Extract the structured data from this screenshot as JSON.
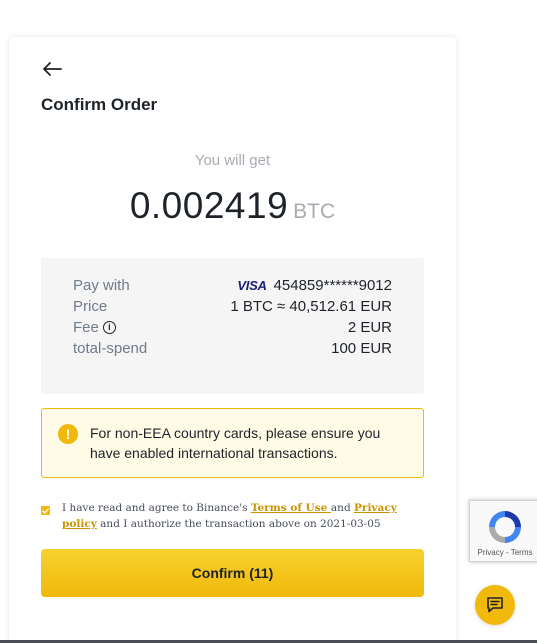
{
  "order": {
    "title": "Confirm Order",
    "you_will_get_label": "You will get",
    "amount": "0.002419",
    "currency": "BTC"
  },
  "details": {
    "pay_with_label": "Pay with",
    "card_brand": "VISA",
    "card_number": "454859******9012",
    "price_label": "Price",
    "price_value": "1 BTC ≈ 40,512.61 EUR",
    "fee_label": "Fee",
    "fee_value": "2 EUR",
    "total_label": "total-spend",
    "total_value": "100 EUR"
  },
  "warning": {
    "icon": "!",
    "text": "For non-EEA country cards, please ensure you have enabled international transactions."
  },
  "agreement": {
    "checked": true,
    "text_before": "I have read and agree to Binance's ",
    "terms_link": "Terms of Use ",
    "and_text": " and ",
    "privacy_link": "Privacy policy",
    "text_after": " and I authorize the transaction above on 2021-03-05"
  },
  "confirm_button": {
    "label": "Confirm (11)"
  },
  "recaptcha": {
    "privacy": "Privacy",
    "separator": " - ",
    "terms": "Terms"
  },
  "colors": {
    "accent": "#f0b90b",
    "accent_light": "#f8d12f",
    "link": "#c99400",
    "warning_bg": "#fefbe6",
    "details_bg": "#f5f5f5",
    "text_primary": "#1e2329",
    "text_secondary": "#707a8a",
    "text_muted": "#a7abb2"
  },
  "icons": {
    "back": "arrow-left-icon",
    "fee_info": "info-icon",
    "warning": "exclamation-icon",
    "checkbox": "check-icon",
    "recaptcha": "recaptcha-logo-icon",
    "chat": "chat-icon"
  }
}
